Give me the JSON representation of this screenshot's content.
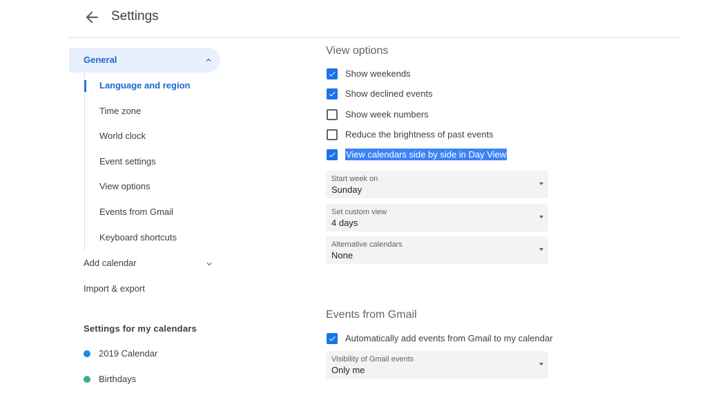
{
  "header": {
    "title": "Settings",
    "back_icon": "arrow-left-icon"
  },
  "sidebar": {
    "general_label": "General",
    "general_items": [
      {
        "label": "Language and region",
        "active": true
      },
      {
        "label": "Time zone",
        "active": false
      },
      {
        "label": "World clock",
        "active": false
      },
      {
        "label": "Event settings",
        "active": false
      },
      {
        "label": "View options",
        "active": false
      },
      {
        "label": "Events from Gmail",
        "active": false
      },
      {
        "label": "Keyboard shortcuts",
        "active": false
      }
    ],
    "add_calendar_label": "Add calendar",
    "import_export_label": "Import & export",
    "my_calendars_heading": "Settings for my calendars",
    "calendars": [
      {
        "label": "2019 Calendar",
        "color": "#1e88e5"
      },
      {
        "label": "Birthdays",
        "color": "#33b679"
      }
    ]
  },
  "view_options": {
    "title": "View options",
    "checkboxes": [
      {
        "label": "Show weekends",
        "checked": true
      },
      {
        "label": "Show declined events",
        "checked": true
      },
      {
        "label": "Show week numbers",
        "checked": false
      },
      {
        "label": "Reduce the brightness of past events",
        "checked": false
      },
      {
        "label": "View calendars side by side in Day View",
        "checked": true,
        "selected_text": true
      }
    ],
    "selects": [
      {
        "caption": "Start week on",
        "value": "Sunday"
      },
      {
        "caption": "Set custom view",
        "value": "4 days"
      },
      {
        "caption": "Alternative calendars",
        "value": "None"
      }
    ]
  },
  "gmail": {
    "title": "Events from Gmail",
    "checkbox": {
      "label": "Automatically add events from Gmail to my calendar",
      "checked": true
    },
    "select": {
      "caption": "Visibility of Gmail events",
      "value": "Only me"
    }
  },
  "colors": {
    "accent": "#1a73e8",
    "active_nav_bg": "#e8f0fe",
    "selection": "#3b82f6"
  }
}
